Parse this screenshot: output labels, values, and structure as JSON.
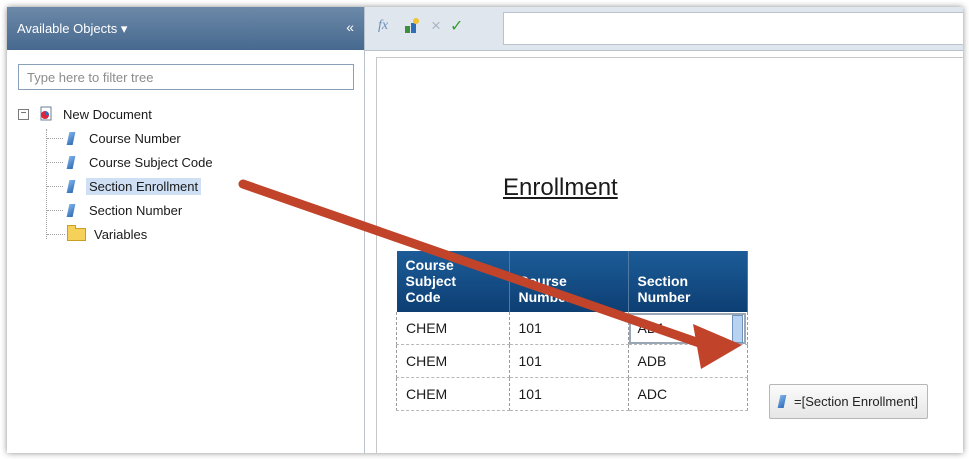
{
  "left_panel": {
    "title": "Available Objects",
    "title_caret": "▾",
    "collapse_glyph": "«",
    "filter_placeholder": "Type here to filter tree",
    "tree": {
      "root": "New Document",
      "toggle": "−",
      "items": [
        {
          "label": "Course Number",
          "icon": "dimension-icon"
        },
        {
          "label": "Course Subject Code",
          "icon": "dimension-icon"
        },
        {
          "label": "Section Enrollment",
          "icon": "dimension-icon",
          "selected": true
        },
        {
          "label": "Section Number",
          "icon": "dimension-icon"
        }
      ],
      "folder": "Variables"
    }
  },
  "toolbar": {
    "formula_glyph": "fx",
    "cancel_glyph": "×",
    "validate_glyph": "✓"
  },
  "report": {
    "title": "Enrollment",
    "table": {
      "headers": [
        [
          "Course",
          "Subject",
          "Code"
        ],
        [
          "Course",
          "Number"
        ],
        [
          "Section",
          "Number"
        ]
      ],
      "rows": [
        [
          "CHEM",
          "101",
          "AD1"
        ],
        [
          "CHEM",
          "101",
          "ADB"
        ],
        [
          "CHEM",
          "101",
          "ADC"
        ]
      ]
    }
  },
  "drag_tooltip": "=[Section Enrollment]",
  "colors": {
    "header_blue": "#0d3f73",
    "panel_header": "#47698f",
    "arrow": "#c0432a",
    "selection": "#cfe0f5"
  }
}
